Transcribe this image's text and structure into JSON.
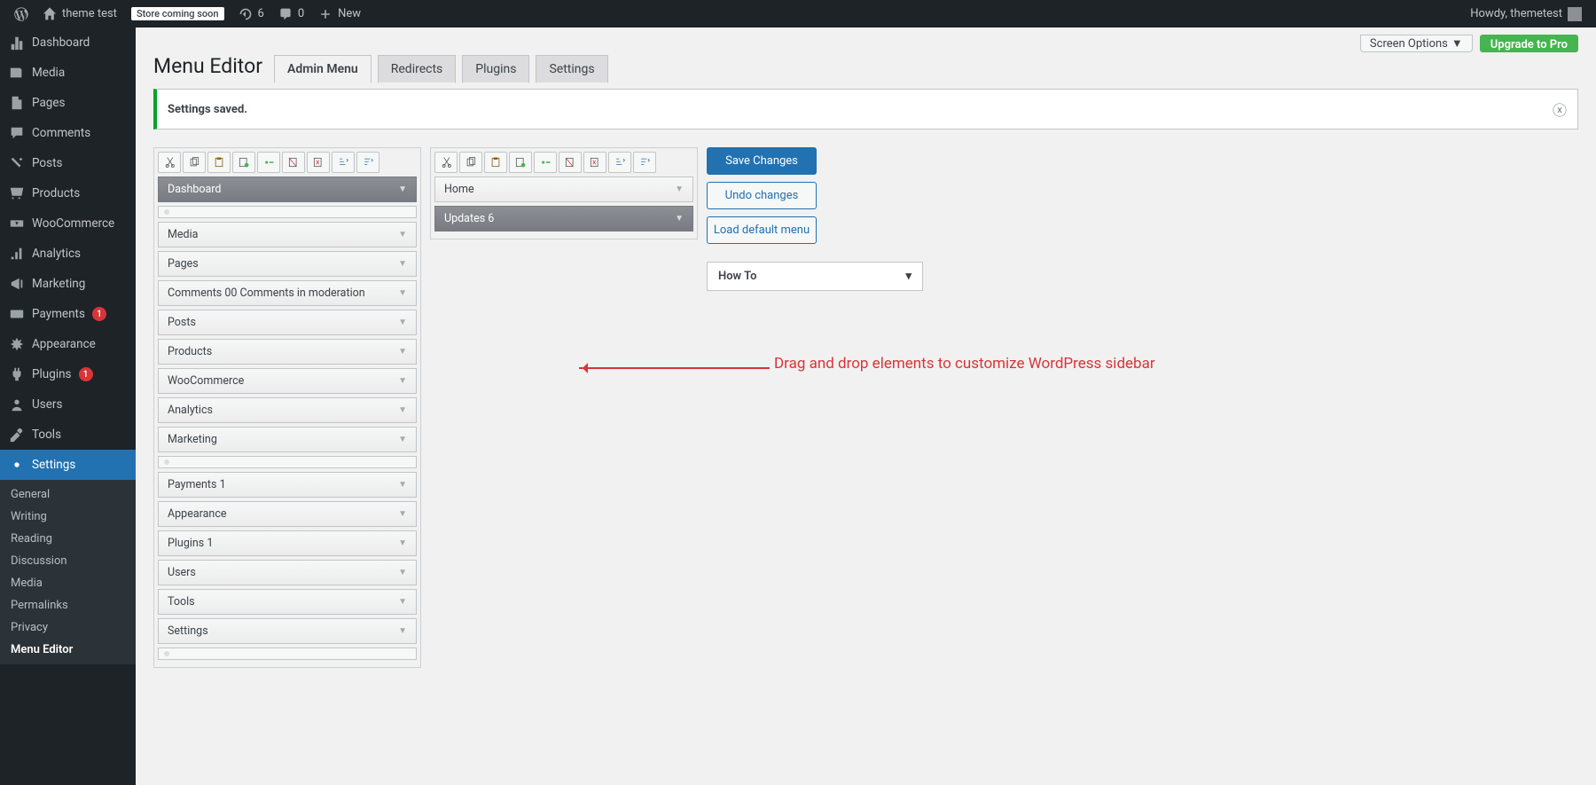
{
  "adminbar": {
    "site_name": "theme test",
    "store_badge": "Store coming soon",
    "updates": "6",
    "comments": "0",
    "new": "New",
    "howdy": "Howdy, themetest"
  },
  "sidebar": {
    "items": [
      {
        "id": "dashboard",
        "label": "Dashboard",
        "icon": "dashboard"
      },
      {
        "id": "media",
        "label": "Media",
        "icon": "media"
      },
      {
        "id": "pages",
        "label": "Pages",
        "icon": "pages"
      },
      {
        "id": "comments",
        "label": "Comments",
        "icon": "comments"
      },
      {
        "id": "posts",
        "label": "Posts",
        "icon": "posts"
      },
      {
        "id": "products",
        "label": "Products",
        "icon": "products"
      },
      {
        "id": "woocommerce",
        "label": "WooCommerce",
        "icon": "woo"
      },
      {
        "id": "analytics",
        "label": "Analytics",
        "icon": "analytics"
      },
      {
        "id": "marketing",
        "label": "Marketing",
        "icon": "marketing"
      },
      {
        "id": "payments",
        "label": "Payments",
        "icon": "payments",
        "badge": "1"
      },
      {
        "id": "appearance",
        "label": "Appearance",
        "icon": "appearance"
      },
      {
        "id": "plugins",
        "label": "Plugins",
        "icon": "plugins",
        "badge": "1"
      },
      {
        "id": "users",
        "label": "Users",
        "icon": "users"
      },
      {
        "id": "tools",
        "label": "Tools",
        "icon": "tools"
      },
      {
        "id": "settings",
        "label": "Settings",
        "icon": "settings",
        "active": true
      }
    ],
    "sub": [
      "General",
      "Writing",
      "Reading",
      "Discussion",
      "Media",
      "Permalinks",
      "Privacy",
      "Menu Editor"
    ]
  },
  "topbar": {
    "screen_options": "Screen Options",
    "upgrade": "Upgrade to Pro"
  },
  "header": {
    "title": "Menu Editor",
    "tabs": [
      "Admin Menu",
      "Redirects",
      "Plugins",
      "Settings"
    ]
  },
  "notice": {
    "text": "Settings saved."
  },
  "panel1_items": [
    {
      "label": "Dashboard",
      "dark": true
    },
    {
      "sep": true
    },
    {
      "label": "Media"
    },
    {
      "label": "Pages"
    },
    {
      "label": "Comments 00 Comments in moderation"
    },
    {
      "label": "Posts"
    },
    {
      "label": "Products"
    },
    {
      "label": "WooCommerce"
    },
    {
      "label": "Analytics"
    },
    {
      "label": "Marketing"
    },
    {
      "sep": true
    },
    {
      "label": "Payments 1"
    },
    {
      "label": "Appearance"
    },
    {
      "label": "Plugins 1"
    },
    {
      "label": "Users"
    },
    {
      "label": "Tools"
    },
    {
      "label": "Settings"
    },
    {
      "sep": true
    }
  ],
  "panel2_items": [
    {
      "label": "Home"
    },
    {
      "label": "Updates 6",
      "dark": true
    }
  ],
  "actions": {
    "save": "Save Changes",
    "undo": "Undo changes",
    "load": "Load default menu",
    "howto": "How To"
  },
  "annotation": "Drag and drop elements to customize WordPress sidebar"
}
